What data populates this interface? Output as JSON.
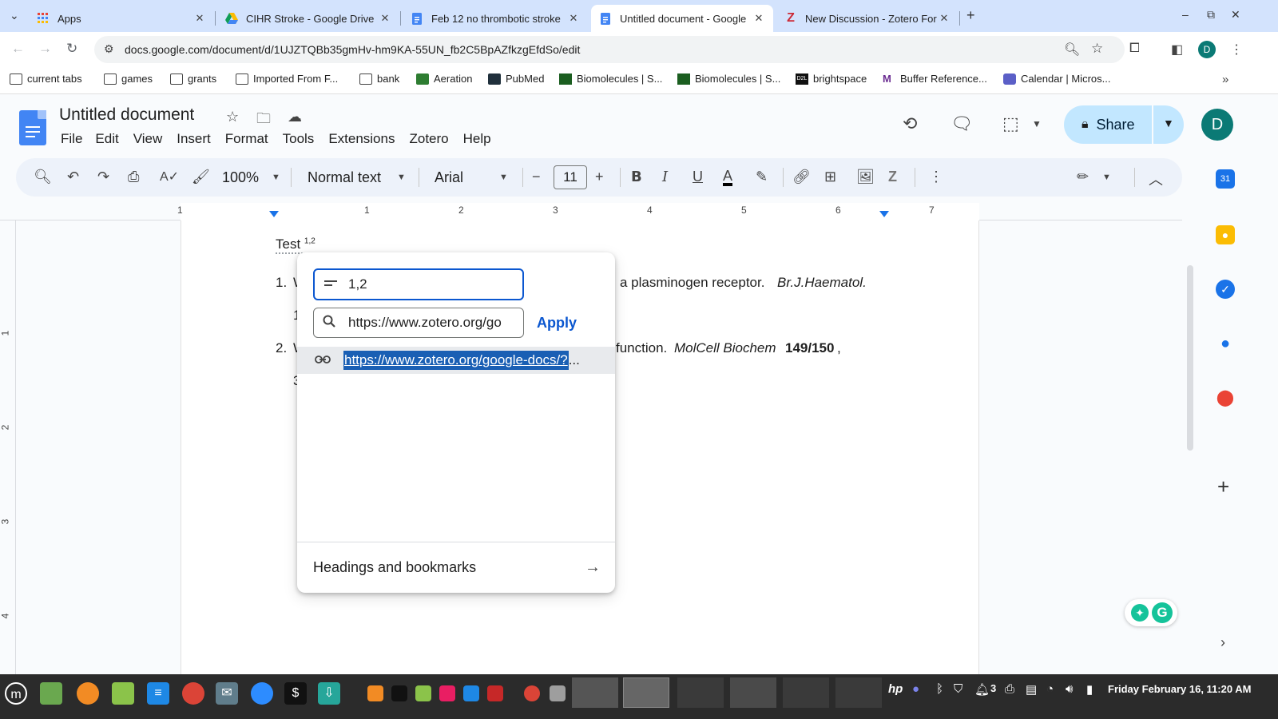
{
  "browser": {
    "tabs": [
      {
        "label": "Apps",
        "icon": "apps-grid-icon"
      },
      {
        "label": "CIHR Stroke - Google Drive",
        "icon": "google-drive-icon"
      },
      {
        "label": "Feb 12 no thrombotic stroke",
        "icon": "google-docs-icon"
      },
      {
        "label": "Untitled document - Google",
        "icon": "google-docs-icon",
        "active": true
      },
      {
        "label": "New Discussion - Zotero For",
        "icon": "zotero-icon"
      }
    ],
    "url": "docs.google.com/document/d/1UJZTQBb35gmHv-hm9KA-55UN_fb2C5BpAZfkzgEfdSo/edit",
    "profile_initial": "D",
    "bookmarks": [
      {
        "label": "current tabs",
        "icon": "folder-icon"
      },
      {
        "label": "games",
        "icon": "folder-icon"
      },
      {
        "label": "grants",
        "icon": "folder-icon"
      },
      {
        "label": "Imported From F...",
        "icon": "folder-icon"
      },
      {
        "label": "bank",
        "icon": "folder-icon"
      },
      {
        "label": "Aeration",
        "icon": "aeration-icon"
      },
      {
        "label": "PubMed",
        "icon": "pubmed-icon"
      },
      {
        "label": "Biomolecules | S...",
        "icon": "biomolecules-icon"
      },
      {
        "label": "Biomolecules | S...",
        "icon": "biomolecules-icon"
      },
      {
        "label": "brightspace",
        "icon": "d2l-icon"
      },
      {
        "label": "Buffer Reference...",
        "icon": "buffer-icon"
      },
      {
        "label": "Calendar | Micros...",
        "icon": "teams-calendar-icon"
      }
    ]
  },
  "docs": {
    "title": "Untitled document",
    "menu": [
      "File",
      "Edit",
      "View",
      "Insert",
      "Format",
      "Tools",
      "Extensions",
      "Zotero",
      "Help"
    ],
    "share_label": "Share",
    "account_initial": "D",
    "toolbar": {
      "zoom": "100%",
      "style": "Normal text",
      "font": "Arial",
      "font_size": "11"
    },
    "ruler_numbers": [
      "1",
      "1",
      "2",
      "3",
      "4",
      "5",
      "6",
      "7"
    ],
    "vruler_numbers": [
      "1",
      "2",
      "3",
      "4"
    ],
    "body": {
      "test_word": "Test",
      "test_sup": "1,2",
      "ref1_num": "1.",
      "ref1_start": "W",
      "ref1_rest": "a plasminogen receptor.",
      "ref1_journal": "Br.J.Haematol.",
      "ref1_line2": "1",
      "ref2_num": "2.",
      "ref2_start": "W",
      "ref2_rest": "function.",
      "ref2_journal": "MolCell Biochem",
      "ref2_vol": "149/150",
      "ref2_comma": ",",
      "ref2_line2": "3"
    }
  },
  "link_popup": {
    "text_value": "1,2",
    "link_value": "https://www.zotero.org/go",
    "apply_label": "Apply",
    "suggestion": "https://www.zotero.org/google-docs/?",
    "suggestion_ellipsis": "...",
    "footer_label": "Headings and bookmarks"
  },
  "taskbar": {
    "clock": "Friday February 16, 11:20 AM",
    "tray_number": "3"
  }
}
